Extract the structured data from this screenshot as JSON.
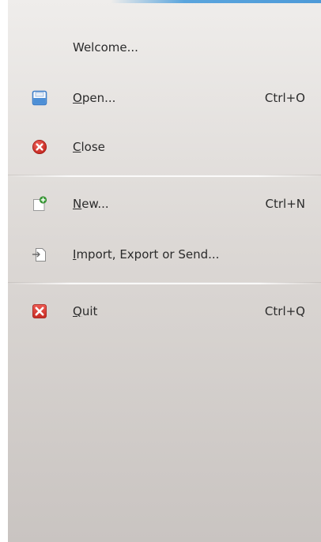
{
  "menu": {
    "items": [
      {
        "label_pre": "",
        "mnemonic": "",
        "label_post": "Welcome...",
        "shortcut": "",
        "icon": "none"
      },
      {
        "label_pre": "",
        "mnemonic": "O",
        "label_post": "pen...",
        "shortcut": "Ctrl+O",
        "icon": "floppy-disk-icon"
      },
      {
        "label_pre": "",
        "mnemonic": "C",
        "label_post": "lose",
        "shortcut": "",
        "icon": "close-circle-icon"
      },
      {
        "label_pre": "",
        "mnemonic": "N",
        "label_post": "ew...",
        "shortcut": "Ctrl+N",
        "icon": "new-document-icon"
      },
      {
        "label_pre": "",
        "mnemonic": "I",
        "label_post": "mport, Export or Send...",
        "shortcut": "",
        "icon": "import-export-icon"
      },
      {
        "label_pre": "",
        "mnemonic": "Q",
        "label_post": "uit",
        "shortcut": "Ctrl+Q",
        "icon": "quit-icon"
      }
    ]
  },
  "colors": {
    "accent": "#4d9ad8",
    "close_red": "#d9302a",
    "quit_red": "#d63a32",
    "new_green": "#3da13a",
    "floppy_blue": "#3f7fc9"
  }
}
